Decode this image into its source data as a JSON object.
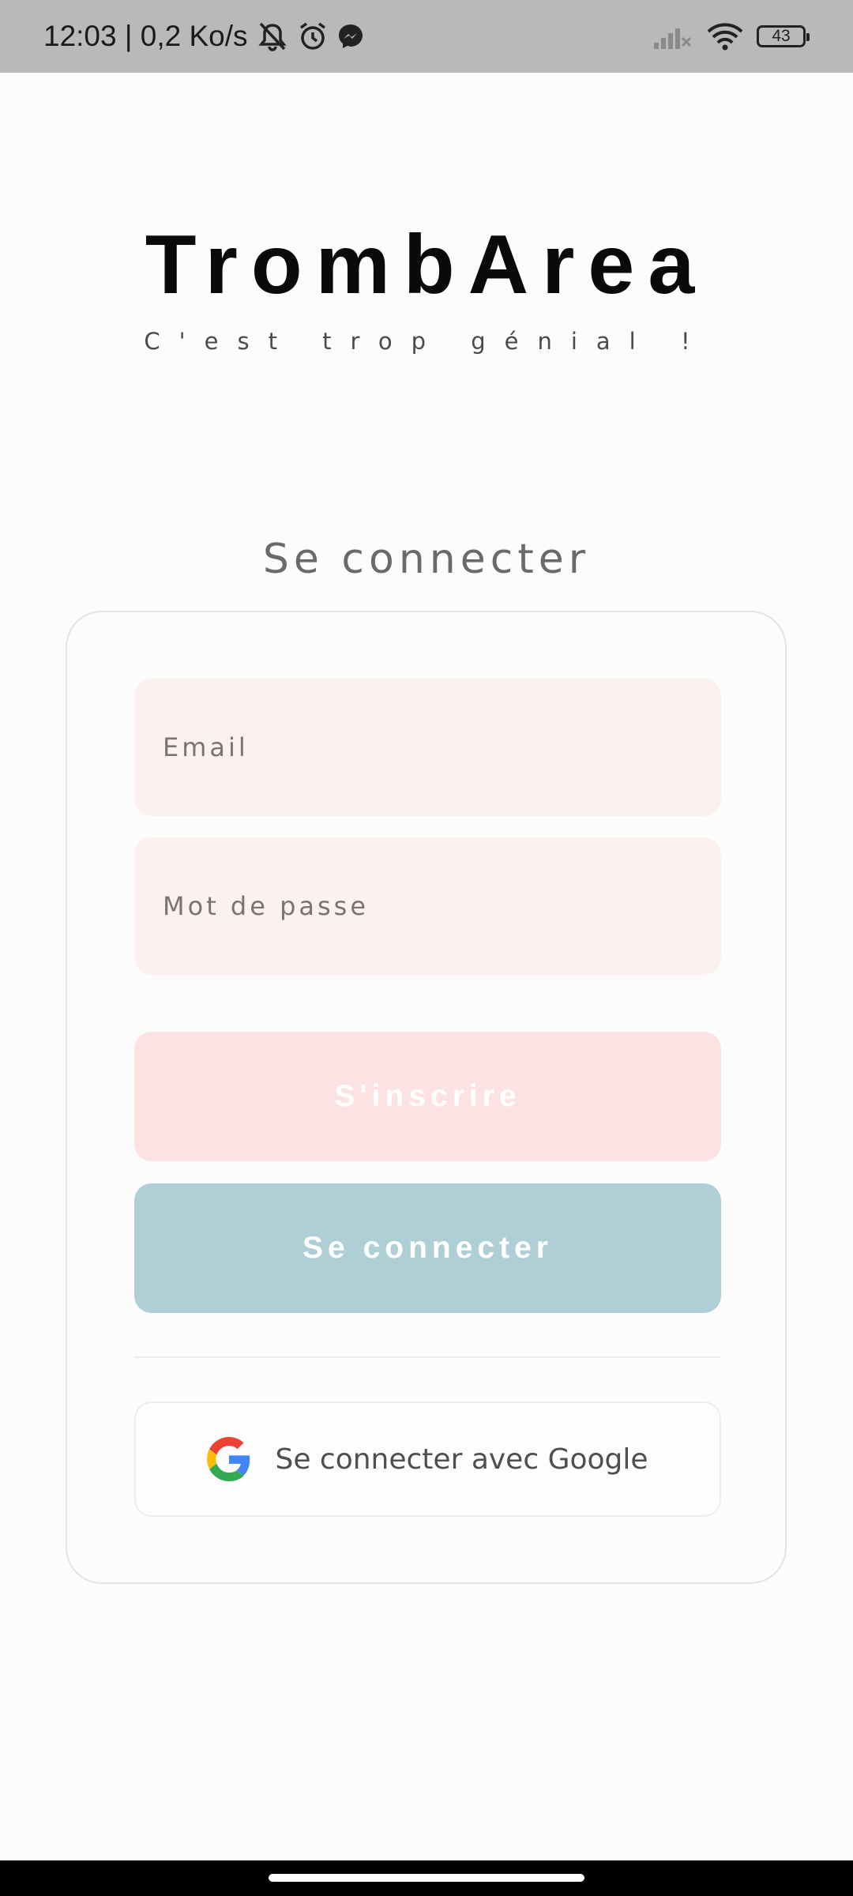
{
  "status_bar": {
    "time_speed": "12:03 | 0,2 Ko/s",
    "battery": "43",
    "icons": [
      "muted-bell-icon",
      "alarm-icon",
      "messenger-icon",
      "signal-icon",
      "wifi-icon",
      "battery-icon"
    ]
  },
  "app": {
    "title": "TrombArea",
    "subtitle": "C'est trop génial !"
  },
  "login": {
    "heading": "Se connecter",
    "email_placeholder": "Email",
    "password_placeholder": "Mot de passe",
    "signup_label": "S'inscrire",
    "login_label": "Se connecter",
    "google_label": "Se connecter avec Google"
  },
  "colors": {
    "field_bg": "#fcf1ef",
    "signup_bg": "#fde2e4",
    "login_bg": "#aecfd6"
  }
}
